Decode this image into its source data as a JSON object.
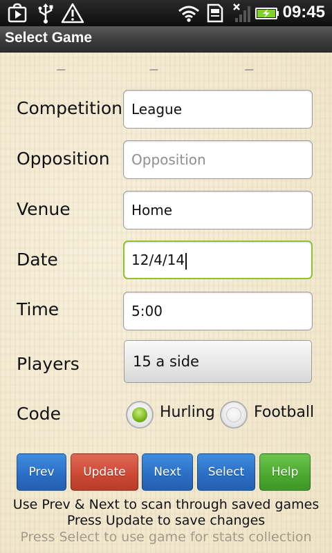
{
  "status_bar": {
    "time": "09:45",
    "icons": [
      "play-store-icon",
      "usb-icon",
      "warning-icon",
      "wifi-icon",
      "sd-card-icon",
      "no-signal-icon",
      "battery-charging-icon"
    ]
  },
  "title_bar": {
    "title": "Select Game"
  },
  "form": {
    "competition": {
      "label": "Competition",
      "value": "League"
    },
    "opposition": {
      "label": "Opposition",
      "value": "",
      "placeholder": "Opposition"
    },
    "venue": {
      "label": "Venue",
      "value": "Home"
    },
    "date": {
      "label": "Date",
      "value": "12/4/14"
    },
    "time": {
      "label": "Time",
      "value": "5:00"
    },
    "players": {
      "label": "Players",
      "selected": "15 a side"
    },
    "code": {
      "label": "Code",
      "options": [
        {
          "label": "Hurling",
          "checked": true
        },
        {
          "label": "Football",
          "checked": false
        }
      ]
    }
  },
  "buttons": {
    "prev": "Prev",
    "update": "Update",
    "next": "Next",
    "select": "Select",
    "help": "Help"
  },
  "help_text": [
    "Use Prev & Next to scan through saved games",
    "Press Update to save changes",
    "Press Select to use game for stats collection"
  ],
  "colors": {
    "accent_green": "#8fc22c",
    "button_blue": "#2c6fc6",
    "button_red": "#cc4a36",
    "button_green": "#4eaa32",
    "background": "#f3ead2"
  }
}
